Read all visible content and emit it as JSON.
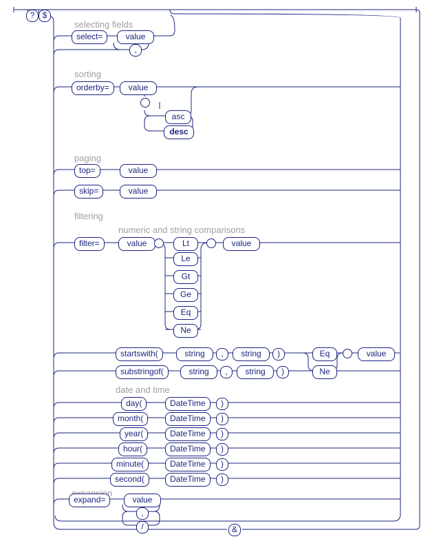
{
  "sections": {
    "selecting": {
      "label": "selecting fields"
    },
    "sorting": {
      "label": "sorting"
    },
    "paging": {
      "label": "paging"
    },
    "filtering": {
      "label": "filtering",
      "sublabel": "numeric and string comparisons",
      "datelabel": "date and time"
    },
    "expansion": {
      "label": "expansion"
    }
  },
  "tokens": {
    "q": "?",
    "dollar": "$",
    "amp": "&",
    "select": "select=",
    "value": "value",
    "comma": ",",
    "orderby": "orderby=",
    "asc": "asc",
    "desc": "desc",
    "top": "top=",
    "skip": "skip=",
    "filter": "filter=",
    "Lt": "Lt",
    "Le": "Le",
    "Gt": "Gt",
    "Ge": "Ge",
    "Eq": "Eq",
    "Ne": "Ne",
    "startswith": "startswith(",
    "substringof": "substringof(",
    "string": "string",
    "rparen": ")",
    "day": "day(",
    "month": "month(",
    "year": "year(",
    "hour": "hour(",
    "minute": "minute(",
    "second": "second(",
    "DateTime": "DateTime",
    "expand": "expand=",
    "slash": "/"
  }
}
